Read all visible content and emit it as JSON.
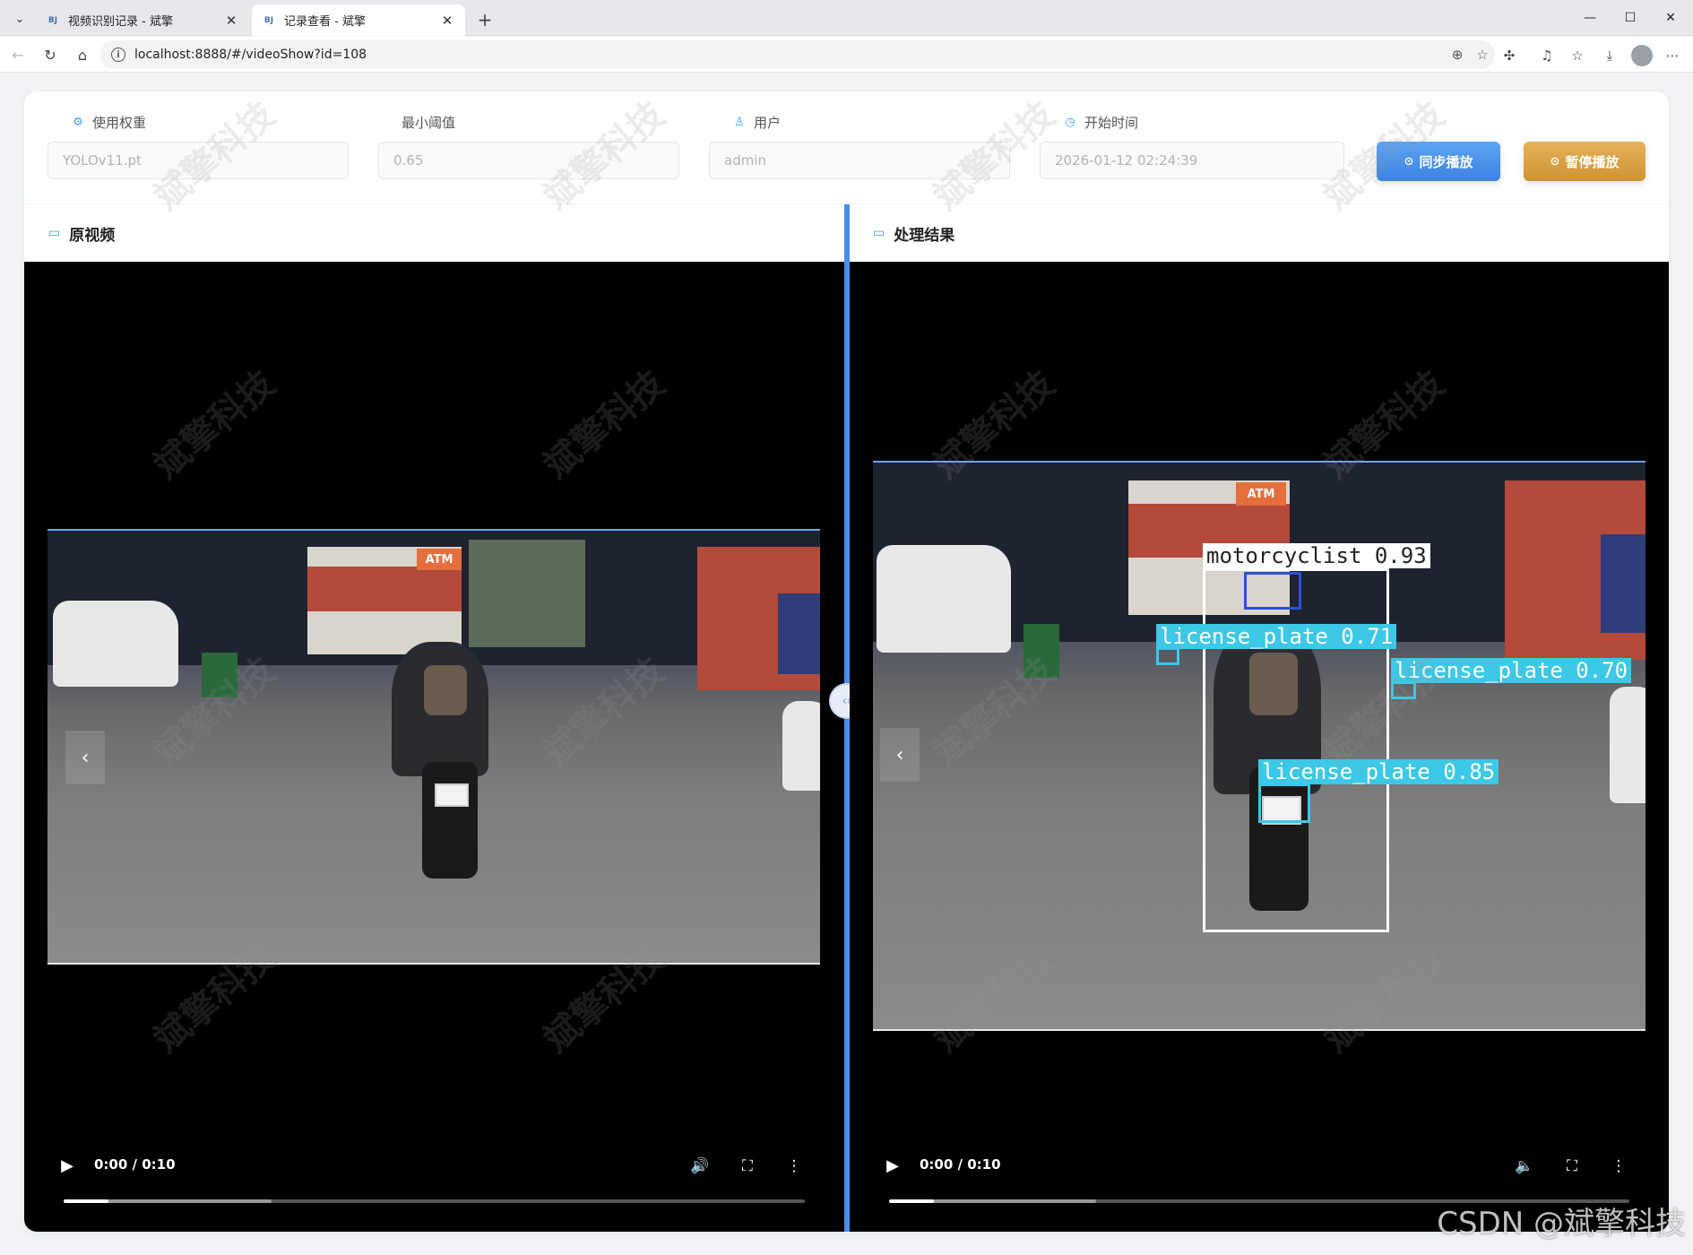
{
  "browser": {
    "tabs": [
      {
        "favicon": "BJ",
        "title": "视频识别记录 - 斌擎",
        "active": false
      },
      {
        "favicon": "BJ",
        "title": "记录查看 - 斌擎",
        "active": true
      }
    ],
    "url": "localhost:8888/#/videoShow?id=108"
  },
  "form": {
    "weight": {
      "label": "使用权重",
      "value": "YOLOv11.pt",
      "icon": "gear-icon"
    },
    "threshold": {
      "label": "最小阈值",
      "value": "0.65"
    },
    "user": {
      "label": "用户",
      "value": "admin",
      "icon": "user-icon"
    },
    "start_time": {
      "label": "开始时间",
      "value": "2026-01-12 02:24:39",
      "icon": "clock-icon"
    },
    "sync_button": "同步播放",
    "pause_button": "暂停播放"
  },
  "panels": {
    "original": {
      "title": "原视频",
      "icon": "video-icon"
    },
    "result": {
      "title": "处理结果",
      "icon": "monitor-icon"
    }
  },
  "player": {
    "original": {
      "time": "0:00 / 0:10",
      "progress": 0.06,
      "buffered": 0.28
    },
    "result": {
      "time": "0:00 / 0:10",
      "progress": 0.06,
      "buffered": 0.28
    }
  },
  "detections": [
    {
      "label": "motorcyclist 0.93",
      "color": "#ffffff"
    },
    {
      "label": "license_plate 0.71",
      "color": "#3cc8e6"
    },
    {
      "label": "license_plate 0.70",
      "color": "#3cc8e6"
    },
    {
      "label": "license_plate 0.85",
      "color": "#3cc8e6"
    }
  ],
  "frame_text": {
    "atm": "ATM"
  },
  "watermark": "斌擎科技",
  "footer_credit": "CSDN @斌擎科技",
  "colors": {
    "accent": "#409eff",
    "sync": "#4a90e8",
    "pause": "#d9a040"
  }
}
